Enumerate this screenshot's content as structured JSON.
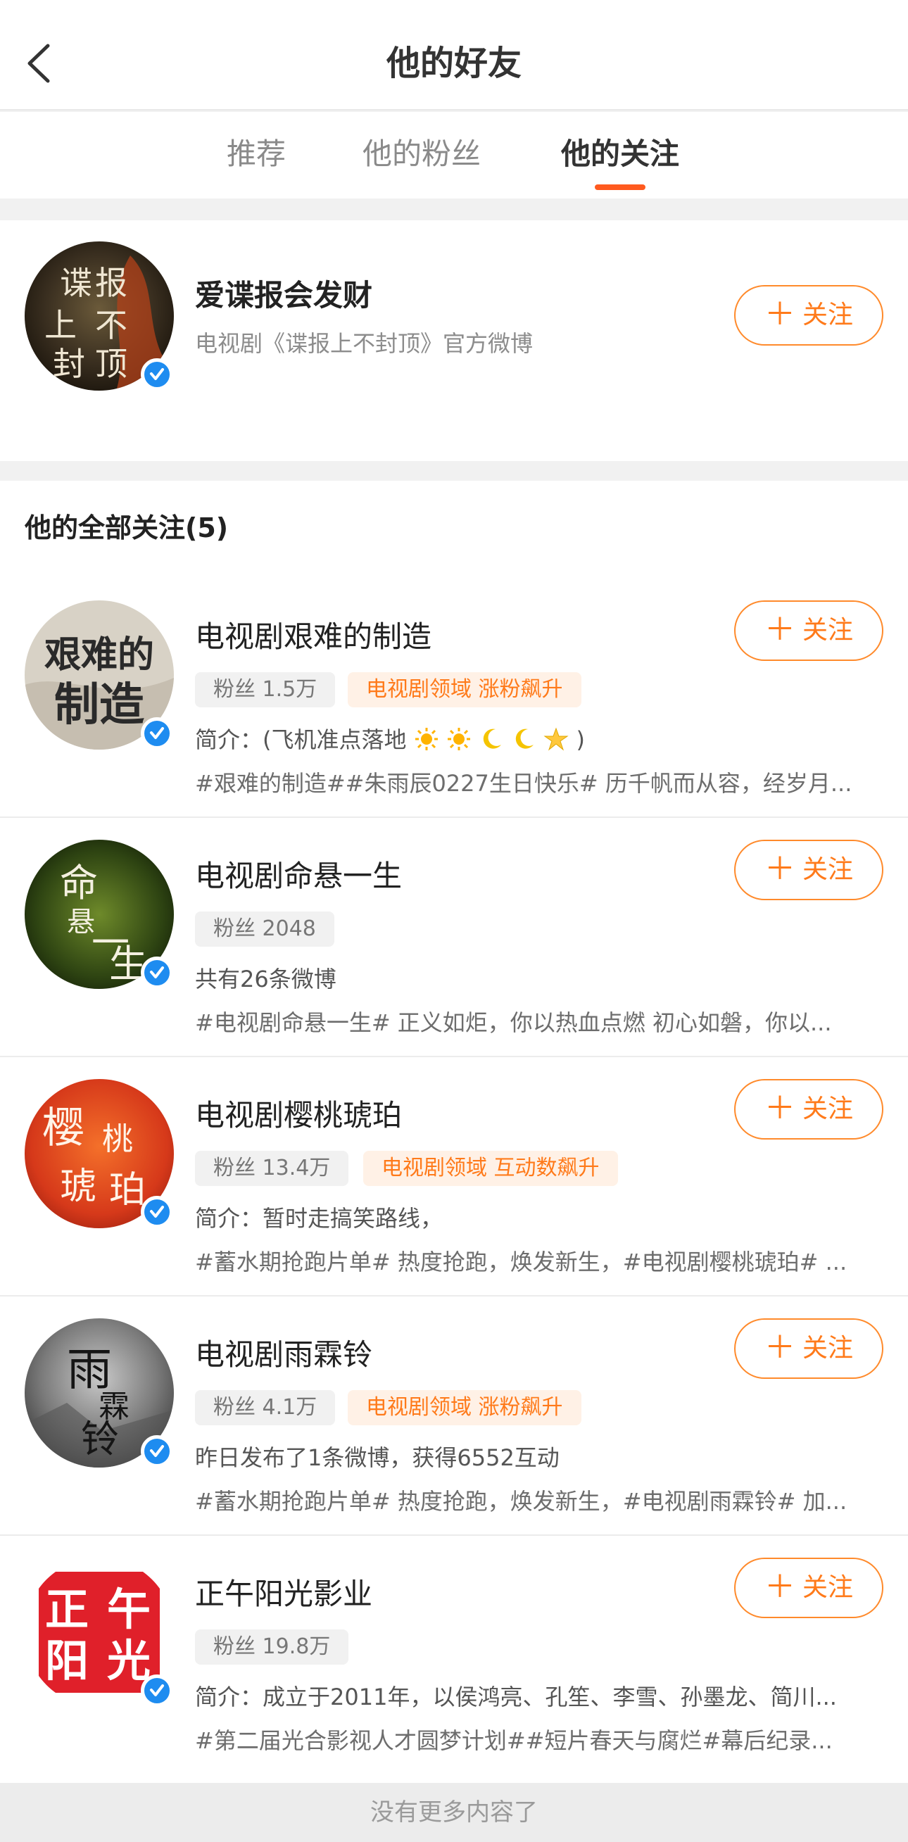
{
  "header": {
    "title": "他的好友",
    "back_icon": "chevron-left-icon"
  },
  "tabs": [
    {
      "label": "推荐",
      "active": false
    },
    {
      "label": "他的粉丝",
      "active": false
    },
    {
      "label": "他的关注",
      "active": true
    }
  ],
  "accent_color": "#ff7a1a",
  "recommended": {
    "name": "爱谍报会发财",
    "desc": "电视剧《谍报上不封顶》官方微博",
    "follow_label": "关注",
    "verified": true
  },
  "all_section": {
    "title": "他的全部关注(5)"
  },
  "accounts": [
    {
      "name": "电视剧艰难的制造",
      "fans": "粉丝 1.5万",
      "badge": "电视剧领域 涨粉飙升",
      "line1": "简介：(飞机准点落地",
      "line1_suffix": ")",
      "line2": "#艰难的制造##朱雨辰0227生日快乐# 历千帆而从容，经岁月...",
      "follow_label": "关注"
    },
    {
      "name": "电视剧命悬一生",
      "fans": "粉丝 2048",
      "badge": "",
      "line1": "共有26条微博",
      "line2": "#电视剧命悬一生# 正义如炬，你以热血点燃 初心如磐，你以...",
      "follow_label": "关注"
    },
    {
      "name": "电视剧樱桃琥珀",
      "fans": "粉丝 13.4万",
      "badge": "电视剧领域 互动数飙升",
      "line1": "简介：暂时走搞笑路线，",
      "line2": "#蓄水期抢跑片单# 热度抢跑，焕发新生，#电视剧樱桃琥珀# ...",
      "follow_label": "关注"
    },
    {
      "name": "电视剧雨霖铃",
      "fans": "粉丝 4.1万",
      "badge": "电视剧领域 涨粉飙升",
      "line1": "昨日发布了1条微博，获得6552互动",
      "line2": "#蓄水期抢跑片单# 热度抢跑，焕发新生，#电视剧雨霖铃# 加...",
      "follow_label": "关注"
    },
    {
      "name": "正午阳光影业",
      "fans": "粉丝 19.8万",
      "badge": "",
      "line1": "简介：成立于2011年，以侯鸿亮、孔笙、李雪、孙墨龙、简川...",
      "line2": "#第二届光合影视人才圆梦计划##短片春天与腐烂#幕后纪录...",
      "follow_label": "关注"
    }
  ],
  "avatar_text": {
    "rec": [
      "谍",
      "报",
      "上",
      "不",
      "封",
      "顶"
    ],
    "a0": [
      "艰难的",
      "制造"
    ],
    "a1": [
      "命",
      "悬",
      "一",
      "生"
    ],
    "a2": [
      "樱",
      "桃",
      "琥",
      "珀"
    ],
    "a3": [
      "雨",
      "霖",
      "铃"
    ],
    "a4": [
      "正",
      "午",
      "阳",
      "光"
    ]
  },
  "footer": "没有更多内容了"
}
